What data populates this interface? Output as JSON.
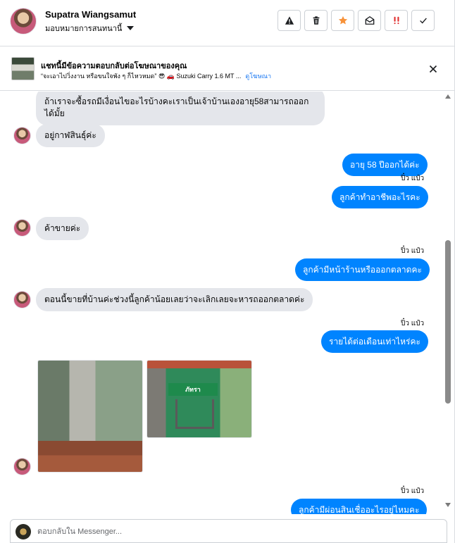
{
  "header": {
    "contact_name": "Supatra Wiangsamut",
    "assign_label": "มอบหมายการสนทนานี้",
    "actions": [
      {
        "icon": "warning-icon"
      },
      {
        "icon": "trash-icon"
      },
      {
        "icon": "star-icon",
        "color": "#f7923a"
      },
      {
        "icon": "envelope-open-icon"
      },
      {
        "icon": "priority-icon",
        "color": "#e02d2d"
      },
      {
        "icon": "check-icon"
      }
    ]
  },
  "ad_banner": {
    "title": "แชทนี้มีข้อความตอบกลับต่อโฆษณาของคุณ",
    "subtitle": "“จะเอาไปวิ่งงาน หรือขนใจพัง ๆ ก็ไหวหมด” 😎 🚗 Suzuki Carry 1.6 MT ...",
    "link": "ดูโฆษณา"
  },
  "messages": {
    "m1": "ถ้าเราจะซื้อรถมีเงื่อนไขอะไรบ้างคะเราเป็นเจ้าบ้านเองอายุ58สามารถออกได้มั้ย",
    "m2": "อยู่กาฬสินธุ์ค่ะ",
    "m3": "อายุ 58 ปีออกได้ค่ะ",
    "seen3": "ปิ๋ว แป๋ว",
    "m4": "ลูกค้าทำอาชีพอะไรคะ",
    "m5": "ค้าขายค่ะ",
    "seen6": "ปิ๋ว แป๋ว",
    "m6": "ลูกค้ามีหน้าร้านหรือออกตลาดคะ",
    "m7": "ตอนนี้ขายที่บ้านค่ะช่วงนี้ลูกค้าน้อยเลยว่าจะเลิกเลยจะหารถออกตลาดค่ะ",
    "seen8": "ปิ๋ว แป๋ว",
    "m8": "รายได้ต่อเดือนเท่าไหร่คะ",
    "photo_sign": "ภัทรา",
    "seen9": "ปิ๋ว แป๋ว",
    "m9": "ลูกค้ามีผ่อนสินเชื่ออะไรอยู่ไหมคะ"
  },
  "composer": {
    "placeholder": "ตอบกลับใน Messenger..."
  },
  "colors": {
    "outgoing_bubble": "#0084ff",
    "incoming_bubble": "#e4e6eb",
    "link": "#1877f2"
  }
}
